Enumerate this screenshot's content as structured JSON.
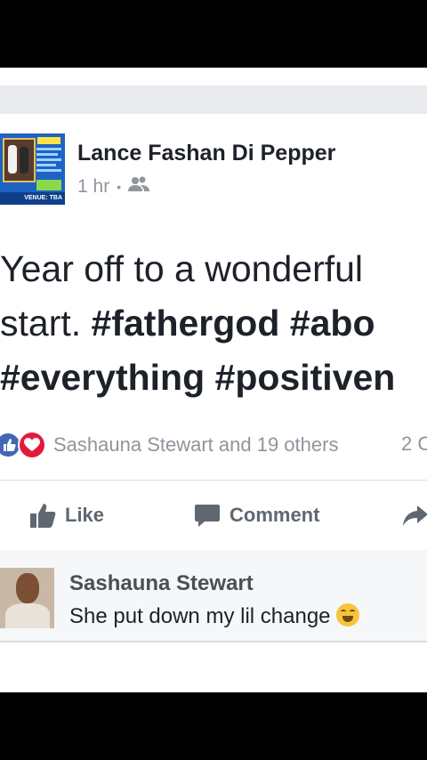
{
  "post": {
    "author": "Lance Fashan Di Pepper",
    "time": "1 hr",
    "separator": "•",
    "privacy_icon": "friends-icon",
    "text_lines": [
      [
        "Year off to a wonderful"
      ],
      [
        "start. ",
        "#fathergod",
        " ",
        "#abo"
      ],
      [
        "#everything",
        " ",
        "#positiven"
      ]
    ],
    "avatar_text": "VENUE: TBA"
  },
  "reactions": {
    "names": "Sashauna Stewart and 19 others",
    "comment_count": "2 C",
    "like_color": "#4267b2",
    "love_color": "#e21b3c"
  },
  "actions": {
    "like_label": "Like",
    "comment_label": "Comment"
  },
  "comment": {
    "author": "Sashauna Stewart",
    "text": "She put down my lil change",
    "emoji_icon": "laughing-emoji-icon"
  }
}
